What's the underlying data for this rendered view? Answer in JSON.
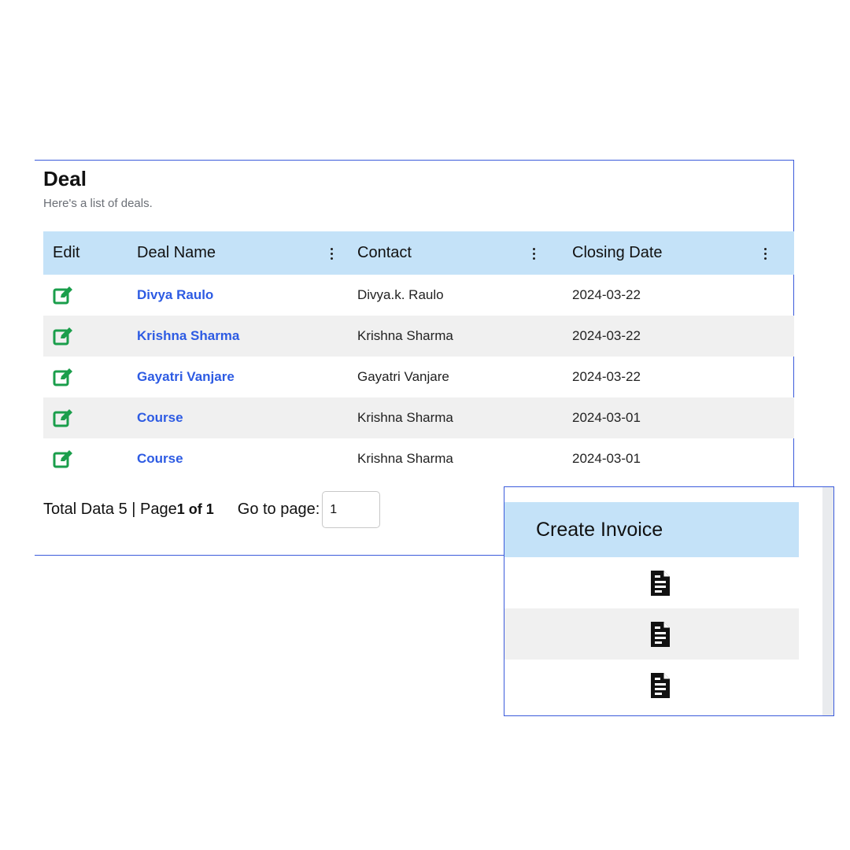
{
  "page": {
    "title": "Deal",
    "subtitle": "Here's a list of deals."
  },
  "table": {
    "columns": [
      "Edit",
      "Deal Name",
      "Contact",
      "Closing Date"
    ],
    "rows": [
      {
        "deal_name": "Divya Raulo",
        "contact": "Divya.k. Raulo",
        "closing_date": "2024-03-22"
      },
      {
        "deal_name": "Krishna Sharma",
        "contact": "Krishna Sharma",
        "closing_date": "2024-03-22"
      },
      {
        "deal_name": "Gayatri Vanjare",
        "contact": "Gayatri Vanjare",
        "closing_date": "2024-03-22"
      },
      {
        "deal_name": "Course",
        "contact": "Krishna Sharma",
        "closing_date": "2024-03-01"
      },
      {
        "deal_name": "Course",
        "contact": "Krishna Sharma",
        "closing_date": "2024-03-01"
      }
    ]
  },
  "pagination": {
    "summary_prefix": "Total Data 5 | Page",
    "page_of": "1 of 1",
    "goto_label": "Go to page:",
    "goto_value": "1"
  },
  "invoice_panel": {
    "header": "Create Invoice",
    "rows": [
      "invoice-doc-icon",
      "invoice-doc-icon",
      "invoice-doc-icon"
    ]
  },
  "icons": {
    "edit": "edit-square-icon",
    "column_menu": "kebab-menu-icon",
    "invoice": "document-icon"
  },
  "colors": {
    "header_bg": "#c4e2f8",
    "link": "#2d5be3",
    "edit_icon": "#1a9e4b",
    "panel_border": "#3b5bdb",
    "stripe": "#f0f0f0"
  }
}
